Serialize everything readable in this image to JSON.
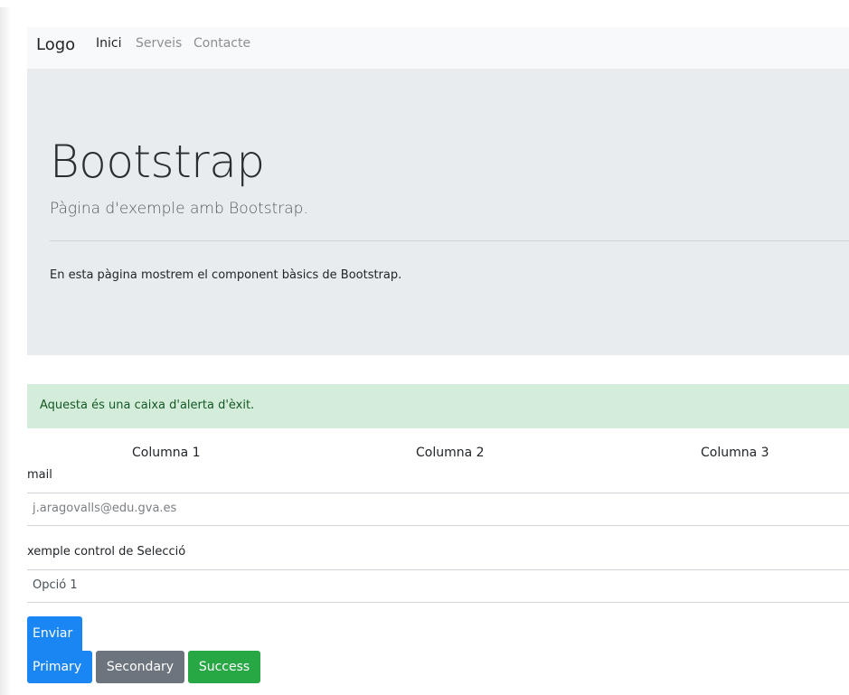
{
  "navbar": {
    "brand": "Logo",
    "links": [
      {
        "label": "Inici",
        "active": true
      },
      {
        "label": "Serveis",
        "active": false
      },
      {
        "label": "Contacte",
        "active": false
      }
    ]
  },
  "jumbotron": {
    "title": "Bootstrap",
    "lead": "Pàgina d'exemple amb Bootstrap.",
    "text": "En esta pàgina mostrem el component bàsics de Bootstrap."
  },
  "alert": {
    "text": "Aquesta és una caixa d'alerta d'èxit.",
    "color": "#d4edda"
  },
  "columns": [
    "Columna 1",
    "Columna 2",
    "Columna 3"
  ],
  "form": {
    "email_label": "mail",
    "email_value": "j.aragovalls@edu.gva.es",
    "select_label": "xemple control de Selecció",
    "select_value": "Opció 1",
    "submit_label": "Enviar"
  },
  "buttons": {
    "primary": "Primary",
    "secondary": "Secondary",
    "success": "Success"
  },
  "colors": {
    "primary": "#1a86f3",
    "secondary": "#6c757d",
    "success": "#28a745"
  }
}
